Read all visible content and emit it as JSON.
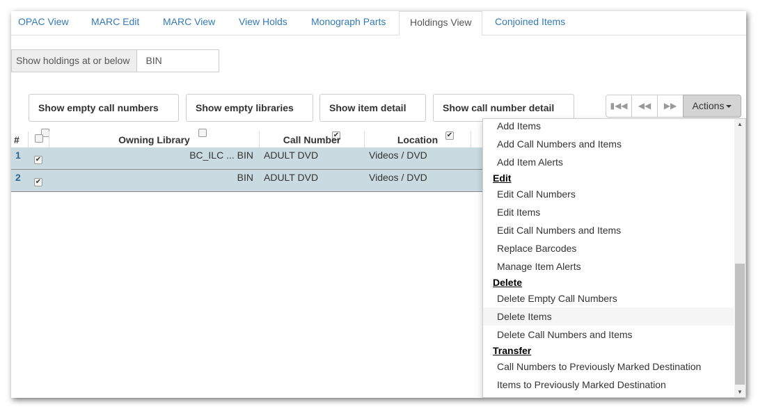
{
  "tabs": [
    {
      "label": "OPAC View",
      "active": false
    },
    {
      "label": "MARC Edit",
      "active": false
    },
    {
      "label": "MARC View",
      "active": false
    },
    {
      "label": "View Holds",
      "active": false
    },
    {
      "label": "Monograph Parts",
      "active": false
    },
    {
      "label": "Holdings View",
      "active": true
    },
    {
      "label": "Conjoined Items",
      "active": false
    }
  ],
  "holdings_filter": {
    "label": "Show holdings at or below",
    "value": "BIN"
  },
  "toggles": [
    {
      "label": "Show empty call numbers",
      "checked": false
    },
    {
      "label": "Show empty libraries",
      "checked": false
    },
    {
      "label": "Show item detail",
      "checked": true
    },
    {
      "label": "Show call number detail",
      "checked": true
    }
  ],
  "pager": {
    "first_icon": "first-page-icon",
    "prev_icon": "prev-page-icon",
    "next_icon": "next-page-icon",
    "actions_label": "Actions"
  },
  "table": {
    "columns": [
      "#",
      "",
      "Owning Library",
      "Call Number",
      "Location"
    ],
    "rows": [
      {
        "num": "1",
        "checked": true,
        "owning_library": "BC_ILC ... BIN",
        "call_number": "ADULT DVD",
        "location": "Videos / DVD"
      },
      {
        "num": "2",
        "checked": true,
        "owning_library": "BIN",
        "call_number": "ADULT DVD",
        "location": "Videos / DVD"
      }
    ],
    "row_color": "#c9dbe0"
  },
  "actions_menu": {
    "items_top": [
      "Add Items",
      "Add Call Numbers and Items",
      "Add Item Alerts"
    ],
    "edit_header": "Edit",
    "edit_items": [
      "Edit Call Numbers",
      "Edit Items",
      "Edit Call Numbers and Items",
      "Replace Barcodes",
      "Manage Item Alerts"
    ],
    "delete_header": "Delete",
    "delete_items": [
      "Delete Empty Call Numbers",
      "Delete Items",
      "Delete Call Numbers and Items"
    ],
    "hovered": "Delete Items",
    "transfer_header": "Transfer",
    "transfer_items": [
      "Call Numbers to Previously Marked Destination",
      "Items to Previously Marked Destination"
    ]
  },
  "check_mark": "✔"
}
